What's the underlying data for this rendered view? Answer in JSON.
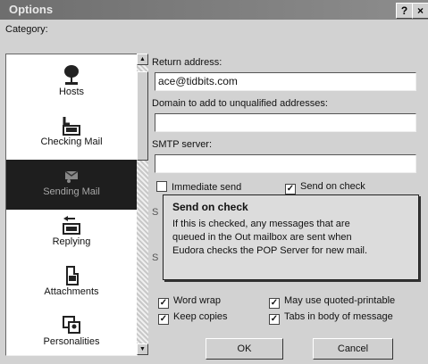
{
  "window": {
    "title": "Options",
    "help_label": "?",
    "close_label": "×"
  },
  "category": {
    "label": "Category:",
    "items": [
      {
        "label": "Hosts",
        "icon": "hosts-icon",
        "selected": false
      },
      {
        "label": "Checking Mail",
        "icon": "checking-mail-icon",
        "selected": false
      },
      {
        "label": "Sending Mail",
        "icon": "sending-mail-icon",
        "selected": true
      },
      {
        "label": "Replying",
        "icon": "replying-icon",
        "selected": false
      },
      {
        "label": "Attachments",
        "icon": "attachments-icon",
        "selected": false
      },
      {
        "label": "Personalities",
        "icon": "personalities-icon",
        "selected": false
      }
    ]
  },
  "fields": {
    "return_address": {
      "label": "Return address:",
      "value": "ace@tidbits.com"
    },
    "domain": {
      "label": "Domain to add to unqualified addresses:",
      "value": ""
    },
    "smtp": {
      "label": "SMTP server:",
      "value": ""
    }
  },
  "checks": {
    "immediate_send": {
      "label": "Immediate send",
      "checked": false
    },
    "send_on_check": {
      "label": "Send on check",
      "checked": true
    },
    "word_wrap": {
      "label": "Word wrap",
      "checked": true
    },
    "may_use_qp": {
      "label": "May use quoted-printable",
      "checked": true
    },
    "keep_copies": {
      "label": "Keep copies",
      "checked": true
    },
    "tabs_in_body": {
      "label": "Tabs in body of message",
      "checked": true
    }
  },
  "tooltip": {
    "title": "Send on check",
    "lines": [
      "If this is checked, any messages that are",
      "queued in the Out mailbox are sent when",
      "Eudora checks the POP Server for new mail."
    ]
  },
  "partial_labels": {
    "a": "S",
    "b": "S"
  },
  "buttons": {
    "ok": "OK",
    "cancel": "Cancel"
  }
}
